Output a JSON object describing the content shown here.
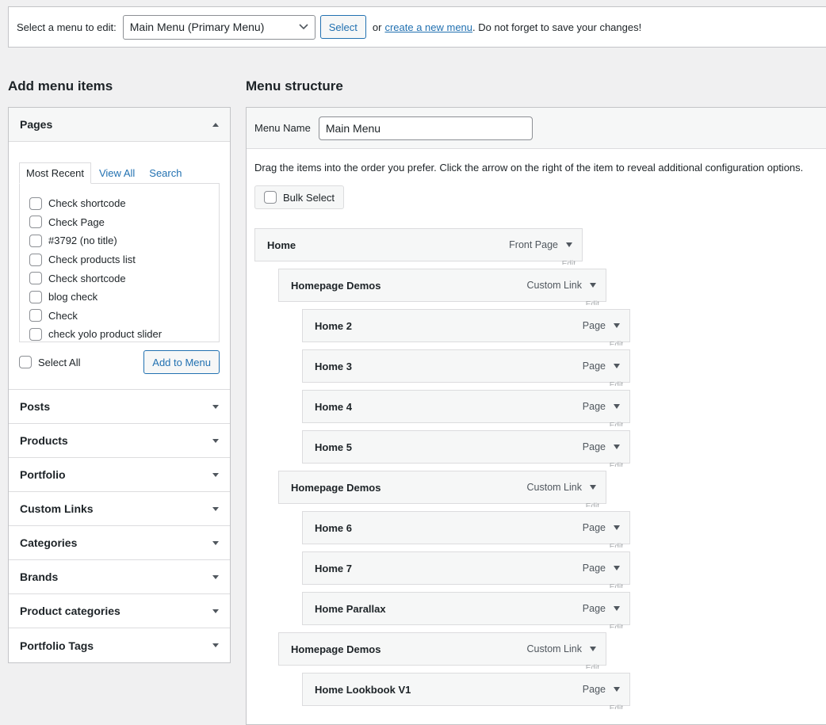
{
  "topbar": {
    "label": "Select a menu to edit:",
    "selected_menu": "Main Menu (Primary Menu)",
    "select_button": "Select",
    "or_text": "or",
    "create_link": "create a new menu",
    "tail_text": ". Do not forget to save your changes!"
  },
  "left": {
    "heading": "Add menu items",
    "pages": {
      "title": "Pages",
      "tabs": [
        "Most Recent",
        "View All",
        "Search"
      ],
      "items": [
        "Check shortcode",
        "Check Page",
        "#3792 (no title)",
        "Check products list",
        "Check shortcode",
        "blog check",
        "Check",
        "check yolo product slider"
      ],
      "select_all": "Select All",
      "add_button": "Add to Menu"
    },
    "sections": [
      "Posts",
      "Products",
      "Portfolio",
      "Custom Links",
      "Categories",
      "Brands",
      "Product categories",
      "Portfolio Tags"
    ]
  },
  "right": {
    "heading": "Menu structure",
    "menu_name_label": "Menu Name",
    "menu_name_value": "Main Menu",
    "instructions": "Drag the items into the order you prefer. Click the arrow on the right of the item to reveal additional configuration options.",
    "bulk_select": "Bulk Select",
    "edit_label": "Edit",
    "items": [
      {
        "title": "Home",
        "type": "Front Page",
        "depth": 0
      },
      {
        "title": "Homepage Demos",
        "type": "Custom Link",
        "depth": 1
      },
      {
        "title": "Home 2",
        "type": "Page",
        "depth": 2
      },
      {
        "title": "Home 3",
        "type": "Page",
        "depth": 2
      },
      {
        "title": "Home 4",
        "type": "Page",
        "depth": 2
      },
      {
        "title": "Home 5",
        "type": "Page",
        "depth": 2
      },
      {
        "title": "Homepage Demos",
        "type": "Custom Link",
        "depth": 1
      },
      {
        "title": "Home 6",
        "type": "Page",
        "depth": 2
      },
      {
        "title": "Home 7",
        "type": "Page",
        "depth": 2
      },
      {
        "title": "Home Parallax",
        "type": "Page",
        "depth": 2
      },
      {
        "title": "Homepage Demos",
        "type": "Custom Link",
        "depth": 1
      },
      {
        "title": "Home Lookbook V1",
        "type": "Page",
        "depth": 2
      }
    ]
  }
}
